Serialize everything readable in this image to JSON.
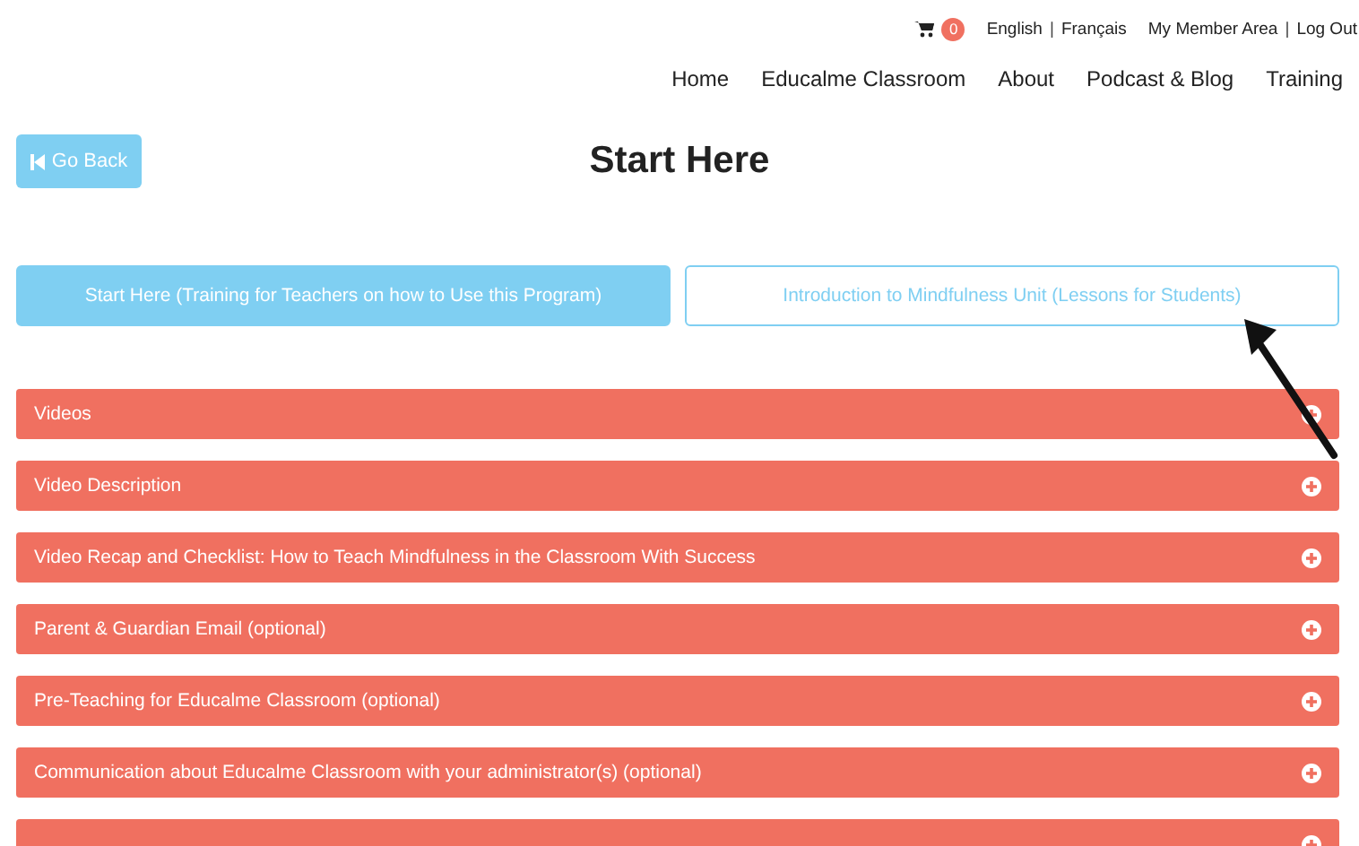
{
  "top_bar": {
    "cart_count": "0",
    "languages": [
      "English",
      "Français"
    ],
    "account_links": [
      "My Member Area",
      "Log Out"
    ],
    "separator": "|"
  },
  "nav": [
    "Home",
    "Educalme Classroom",
    "About",
    "Podcast & Blog",
    "Training"
  ],
  "back_button": "Go Back",
  "title": "Start Here",
  "tabs": [
    {
      "label": "Start Here (Training for Teachers on how to Use this Program)",
      "selected": true
    },
    {
      "label": "Introduction to Mindfulness Unit (Lessons for Students)",
      "selected": false
    }
  ],
  "sections": [
    {
      "label": "Videos",
      "expanded": false
    },
    {
      "label": "Video Description",
      "expanded": false
    },
    {
      "label": "Video Recap and Checklist: How to Teach Mindfulness in the Classroom With Success",
      "expanded": false
    },
    {
      "label": "Parent & Guardian Email (optional)",
      "expanded": false
    },
    {
      "label": "Pre-Teaching for Educalme Classroom (optional)",
      "expanded": false
    },
    {
      "label": "Communication about Educalme Classroom with your administrator(s) (optional)",
      "expanded": false
    },
    {
      "expanded": false
    }
  ]
}
